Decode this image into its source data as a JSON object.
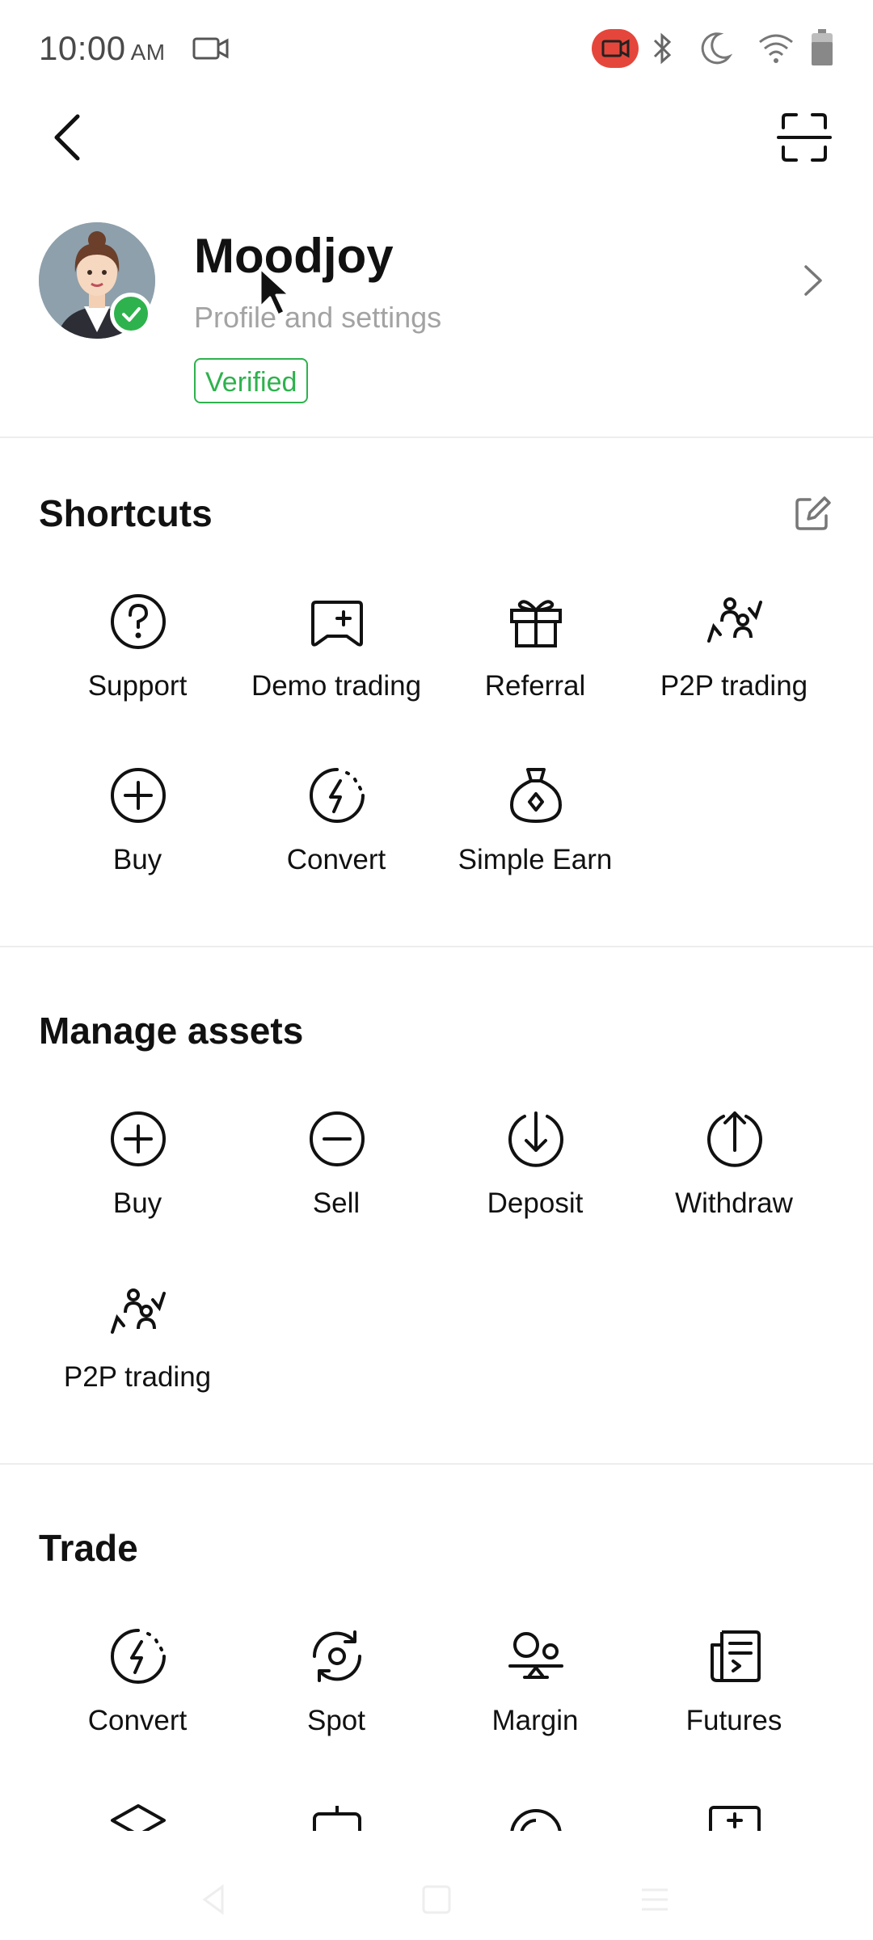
{
  "status_bar": {
    "time": "10:00",
    "ampm": "AM"
  },
  "profile": {
    "username": "Moodjoy",
    "subtitle": "Profile and settings",
    "badge": "Verified"
  },
  "sections": {
    "shortcuts": {
      "title": "Shortcuts",
      "items": [
        {
          "label": "Support",
          "icon": "help-circle-icon"
        },
        {
          "label": "Demo trading",
          "icon": "gamepad-icon"
        },
        {
          "label": "Referral",
          "icon": "gift-icon"
        },
        {
          "label": "P2P trading",
          "icon": "p2p-users-icon"
        },
        {
          "label": "Buy",
          "icon": "plus-circle-icon"
        },
        {
          "label": "Convert",
          "icon": "convert-bolt-icon"
        },
        {
          "label": "Simple Earn",
          "icon": "money-bag-icon"
        }
      ]
    },
    "manage_assets": {
      "title": "Manage assets",
      "items": [
        {
          "label": "Buy",
          "icon": "plus-circle-icon"
        },
        {
          "label": "Sell",
          "icon": "minus-circle-icon"
        },
        {
          "label": "Deposit",
          "icon": "arrow-down-circle-icon"
        },
        {
          "label": "Withdraw",
          "icon": "arrow-up-circle-icon"
        },
        {
          "label": "P2P trading",
          "icon": "p2p-users-icon"
        }
      ]
    },
    "trade": {
      "title": "Trade",
      "items": [
        {
          "label": "Convert",
          "icon": "convert-bolt-icon"
        },
        {
          "label": "Spot",
          "icon": "spot-rotate-icon"
        },
        {
          "label": "Margin",
          "icon": "margin-scale-icon"
        },
        {
          "label": "Futures",
          "icon": "futures-doc-icon"
        }
      ]
    }
  },
  "colors": {
    "accent_green": "#2eb24d",
    "record_red": "#e5463b"
  }
}
